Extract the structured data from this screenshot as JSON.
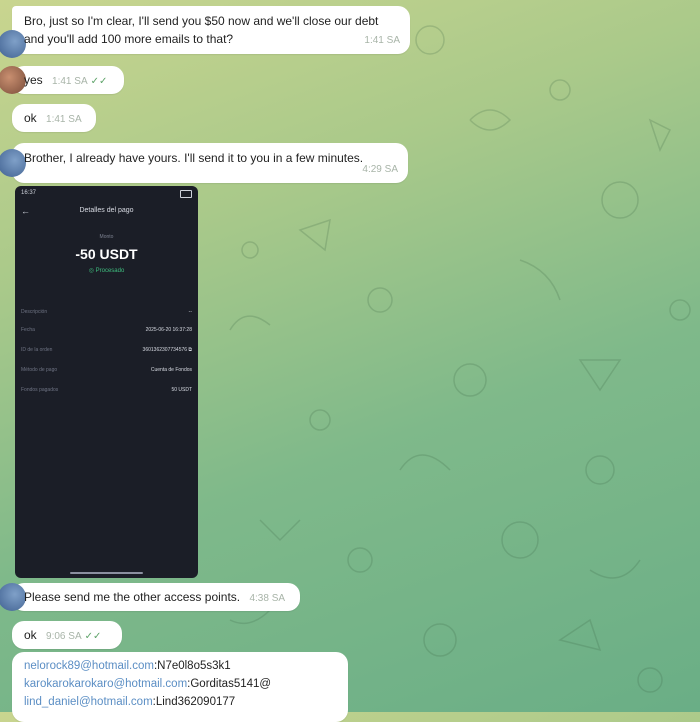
{
  "colors": {
    "bubble": "#ffffff",
    "timestamp": "#a8b4a8",
    "read_check": "#5fa46a",
    "email_link": "#5b8ec4",
    "phone_bg": "#1b1e27",
    "phone_status_green": "#3fbf7f"
  },
  "messages": [
    {
      "line1": "Bro, just so I'm clear, I'll send you $50 now and we'll close our debt",
      "line2": "and you'll add 100 more emails to that?",
      "time": "1:41 SA"
    },
    {
      "text": "yes",
      "time": "1:41 SA",
      "check": "✓✓"
    },
    {
      "text": "ok",
      "time": "1:41 SA"
    },
    {
      "text": "Brother, I already have yours. I'll send it to you in a few minutes.",
      "time": "4:29 SA"
    },
    {
      "text": "Please send me the other access points.",
      "time": "4:38 SA"
    },
    {
      "text": "ok",
      "time": "9:06 SA",
      "check": "✓✓"
    }
  ],
  "phone": {
    "status_time": "16:37",
    "back_icon": "arrow-left-icon",
    "title": "Detalles del pago",
    "sub": "Monto",
    "amount": "-50 USDT",
    "status": "◎ Procesado",
    "rows": [
      {
        "label": "Descripción",
        "value": "--"
      },
      {
        "label": "Fecha",
        "value": "2025-06-20 16:37:28"
      },
      {
        "label": "ID de la orden",
        "value": "3601362307734576 ⧉"
      },
      {
        "label": "Método de pago",
        "value": "Cuenta de Fondos"
      },
      {
        "label": "Fondos pagados",
        "value": "50 USDT"
      }
    ]
  },
  "credentials": [
    {
      "email": "nelorock89@hotmail.com",
      "pass": ":N7e0l8o5s3k1"
    },
    {
      "email": "karokarokarokaro@hotmail.com",
      "pass": ":Gorditas5141@"
    },
    {
      "email": "lind_daniel@hotmail.com",
      "pass": ":Lind362090177"
    }
  ]
}
